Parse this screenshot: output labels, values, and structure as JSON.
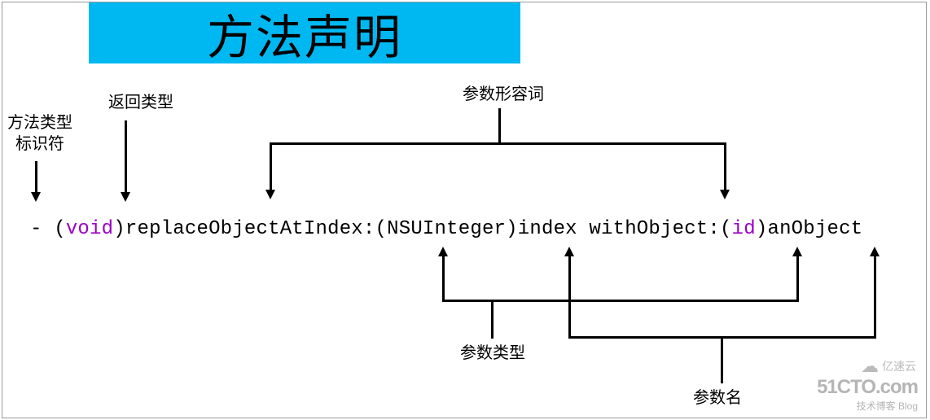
{
  "title": "方法声明",
  "labels": {
    "method_type_identifier": "方法类型\n标识符",
    "return_type": "返回类型",
    "param_adjective": "参数形容词",
    "param_type": "参数类型",
    "param_name": "参数名"
  },
  "code": {
    "minus": "- ",
    "open1": "(",
    "void": "void",
    "close1": ")",
    "method_part1": "replaceObjectAtIndex:",
    "open2": "(",
    "type1": "NSUInteger",
    "close2": ")",
    "name1": "index ",
    "method_part2": "withObject:",
    "open3": "(",
    "id": "id",
    "close3": ")",
    "name2": "anObject"
  },
  "watermark": {
    "main": "51CTO.com",
    "sub": "技术博客   Blog",
    "yisu": "亿速云"
  }
}
